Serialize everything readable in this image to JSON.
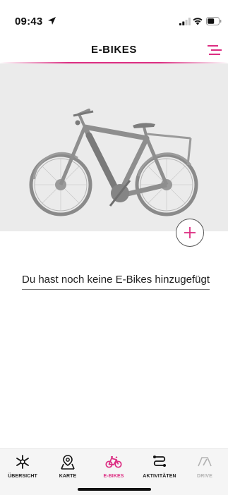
{
  "status_bar": {
    "time": "09:43",
    "icons": [
      "location-arrow-icon",
      "signal-icon",
      "wifi-icon",
      "battery-icon"
    ]
  },
  "header": {
    "title": "E-BIKES",
    "menu_icon": "menu-icon"
  },
  "main": {
    "image": "e-bike-placeholder-image",
    "add_button_icon": "plus-icon",
    "empty_message": "Du hast noch keine E-Bikes hinzugefügt"
  },
  "tabbar": {
    "tabs": [
      {
        "label": "ÜBERSICHT",
        "icon": "overview-icon",
        "state": "normal"
      },
      {
        "label": "KARTE",
        "icon": "map-pin-icon",
        "state": "normal"
      },
      {
        "label": "E-BIKES",
        "icon": "bike-icon",
        "state": "active"
      },
      {
        "label": "AKTIVITÄTEN",
        "icon": "route-icon",
        "state": "normal"
      },
      {
        "label": "DRIVE",
        "icon": "speedometer-icon",
        "state": "disabled"
      }
    ]
  },
  "colors": {
    "accent": "#dc2d82",
    "panel_bg": "#ebebeb",
    "tabbar_bg": "#f5f5f5",
    "disabled": "#b3b3b3"
  }
}
